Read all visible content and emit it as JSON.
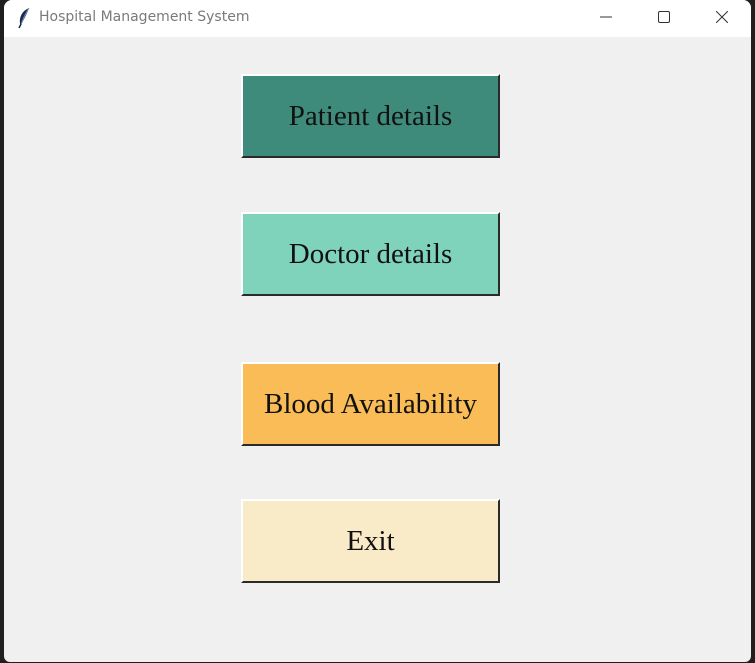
{
  "window": {
    "title": "Hospital Management System"
  },
  "buttons": {
    "patient": "Patient details",
    "doctor": "Doctor details",
    "blood": "Blood Availability",
    "exit": "Exit"
  },
  "colors": {
    "patient": "#3f8b7b",
    "doctor": "#80d3bb",
    "blood": "#f9bc56",
    "exit": "#f9eac8",
    "background": "#f0f0f0"
  },
  "icons": {
    "app": "feather-icon",
    "minimize": "minimize-icon",
    "maximize": "maximize-icon",
    "close": "close-icon"
  }
}
